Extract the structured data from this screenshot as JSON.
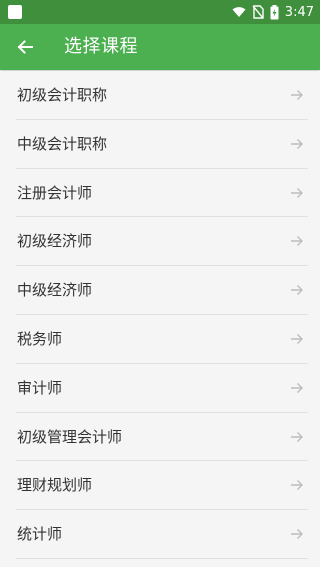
{
  "status_bar": {
    "time": "3:47"
  },
  "toolbar": {
    "title": "选择课程",
    "back_icon": "arrow-left-icon"
  },
  "colors": {
    "toolbar": "#4caf50",
    "status_bar": "#3f8f3c",
    "background": "#f5f5f5",
    "divider": "#e0e0e0",
    "text": "#333333",
    "arrow": "#bdbdbd"
  },
  "courses": [
    {
      "label": "初级会计职称"
    },
    {
      "label": "中级会计职称"
    },
    {
      "label": "注册会计师"
    },
    {
      "label": "初级经济师"
    },
    {
      "label": "中级经济师"
    },
    {
      "label": "税务师"
    },
    {
      "label": "审计师"
    },
    {
      "label": "初级管理会计师"
    },
    {
      "label": "理财规划师"
    },
    {
      "label": "统计师"
    }
  ]
}
